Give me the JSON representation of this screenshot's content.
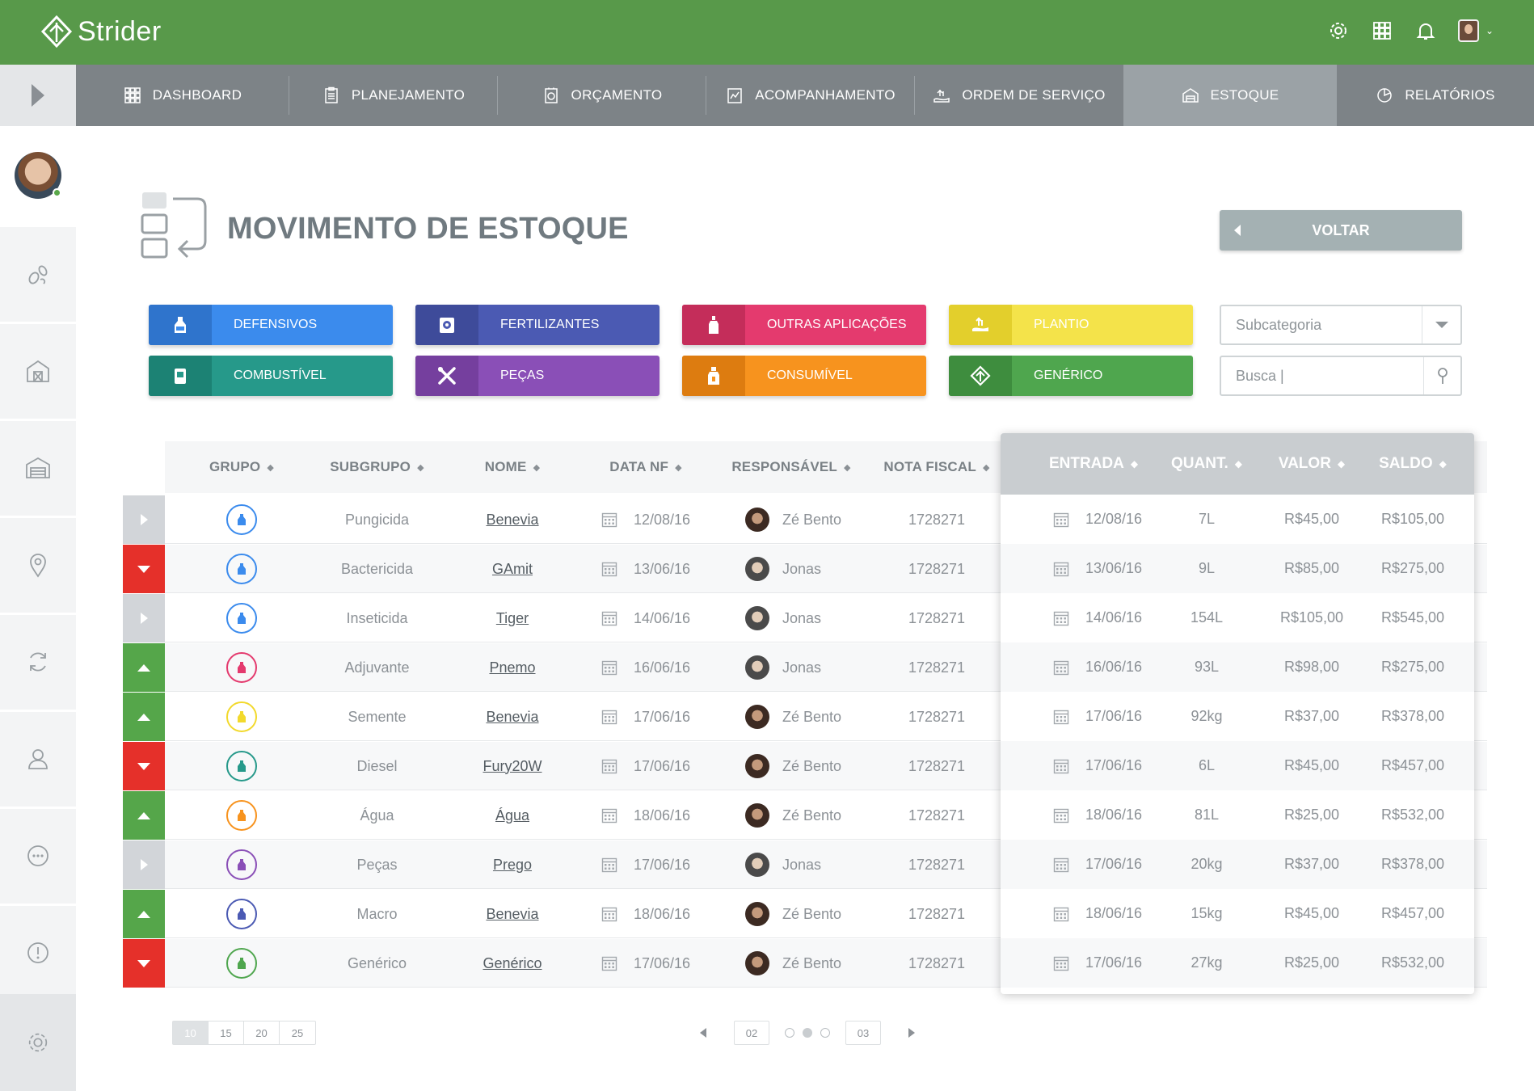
{
  "app": {
    "name": "Strider"
  },
  "nav": {
    "tabs": [
      {
        "label": "DASHBOARD",
        "icon": "grid-icon"
      },
      {
        "label": "PLANEJAMENTO",
        "icon": "clipboard-icon"
      },
      {
        "label": "ORÇAMENTO",
        "icon": "budget-icon"
      },
      {
        "label": "ACOMPANHAMENTO",
        "icon": "chart-icon"
      },
      {
        "label": "ORDEM DE SERVIÇO",
        "icon": "service-order-icon"
      },
      {
        "label": "ESTOQUE",
        "icon": "warehouse-icon",
        "active": true
      },
      {
        "label": "RELATÓRIOS",
        "icon": "pie-icon"
      }
    ]
  },
  "page": {
    "title": "MOVIMENTO DE ESTOQUE",
    "back_label": "VOLTAR"
  },
  "categories": [
    {
      "label": "DEFENSIVOS",
      "color": "#3b8bed",
      "dark": "#2f74cc",
      "icon": "bottle-icon"
    },
    {
      "label": "FERTILIZANTES",
      "color": "#4b5ab3",
      "dark": "#3e4b9a",
      "icon": "fertilizer-icon"
    },
    {
      "label": "OUTRAS APLICAÇÕES",
      "color": "#e43a6e",
      "dark": "#c42d5a",
      "icon": "spray-bottle-icon"
    },
    {
      "label": "PLANTIO",
      "color": "#f4e34a",
      "dark": "#e3cf2c",
      "icon": "planting-icon"
    },
    {
      "label": "COMBUSTÍVEL",
      "color": "#26998a",
      "dark": "#1c8274",
      "icon": "fuel-icon"
    },
    {
      "label": "PEÇAS",
      "color": "#8a4fb7",
      "dark": "#753f9e",
      "icon": "tools-icon"
    },
    {
      "label": "CONSUMÍVEL",
      "color": "#f7931e",
      "dark": "#dd7c10",
      "icon": "consumable-icon"
    },
    {
      "label": "GENÉRICO",
      "color": "#4fa64e",
      "dark": "#3e8d3e",
      "icon": "diamond-icon"
    }
  ],
  "filters": {
    "subcategory_placeholder": "Subcategoria",
    "search_value": "Busca |"
  },
  "table": {
    "columns": [
      "GRUPO",
      "SUBGRUPO",
      "NOME",
      "DATA NF",
      "RESPONSÁVEL",
      "NOTA FISCAL"
    ],
    "panel_columns": [
      "ENTRADA",
      "QUANT.",
      "VALOR",
      "SALDO"
    ],
    "rows": [
      {
        "status": "neutral",
        "group_color": "#3b8bed",
        "subgroup": "Pungicida",
        "name": "Benevia",
        "date_nf": "12/08/16",
        "responsible": "Zé Bento",
        "nota_fiscal": "1728271",
        "entry": "12/08/16",
        "qty": "7L",
        "value": "R$45,00",
        "balance": "R$105,00"
      },
      {
        "status": "down",
        "group_color": "#3b8bed",
        "subgroup": "Bactericida",
        "name": "GAmit",
        "date_nf": "13/06/16",
        "responsible": "Jonas",
        "nota_fiscal": "1728271",
        "entry": "13/06/16",
        "qty": "9L",
        "value": "R$85,00",
        "balance": "R$275,00"
      },
      {
        "status": "neutral",
        "group_color": "#3b8bed",
        "subgroup": "Inseticida",
        "name": "Tiger",
        "date_nf": "14/06/16",
        "responsible": "Jonas",
        "nota_fiscal": "1728271",
        "entry": "14/06/16",
        "qty": "154L",
        "value": "R$105,00",
        "balance": "R$545,00"
      },
      {
        "status": "up",
        "group_color": "#e43a6e",
        "subgroup": "Adjuvante",
        "name": "Pnemo",
        "date_nf": "16/06/16",
        "responsible": "Jonas",
        "nota_fiscal": "1728271",
        "entry": "16/06/16",
        "qty": "93L",
        "value": "R$98,00",
        "balance": "R$275,00"
      },
      {
        "status": "up",
        "group_color": "#f2d92c",
        "subgroup": "Semente",
        "name": "Benevia",
        "date_nf": "17/06/16",
        "responsible": "Zé Bento",
        "nota_fiscal": "1728271",
        "entry": "17/06/16",
        "qty": "92kg",
        "value": "R$37,00",
        "balance": "R$378,00"
      },
      {
        "status": "down",
        "group_color": "#26998a",
        "subgroup": "Diesel",
        "name": "Fury20W",
        "date_nf": "17/06/16",
        "responsible": "Zé Bento",
        "nota_fiscal": "1728271",
        "entry": "17/06/16",
        "qty": "6L",
        "value": "R$45,00",
        "balance": "R$457,00"
      },
      {
        "status": "up",
        "group_color": "#f7931e",
        "subgroup": "Água",
        "name": "Água",
        "date_nf": "18/06/16",
        "responsible": "Zé Bento",
        "nota_fiscal": "1728271",
        "entry": "18/06/16",
        "qty": "81L",
        "value": "R$25,00",
        "balance": "R$532,00"
      },
      {
        "status": "neutral",
        "group_color": "#8a4fb7",
        "subgroup": "Peças",
        "name": "Prego",
        "date_nf": "17/06/16",
        "responsible": "Jonas",
        "nota_fiscal": "1728271",
        "entry": "17/06/16",
        "qty": "20kg",
        "value": "R$37,00",
        "balance": "R$378,00"
      },
      {
        "status": "up",
        "group_color": "#4b5ab3",
        "subgroup": "Macro",
        "name": "Benevia",
        "date_nf": "18/06/16",
        "responsible": "Zé Bento",
        "nota_fiscal": "1728271",
        "entry": "18/06/16",
        "qty": "15kg",
        "value": "R$45,00",
        "balance": "R$457,00"
      },
      {
        "status": "down",
        "group_color": "#4fa64e",
        "subgroup": "Genérico",
        "name": "Genérico",
        "date_nf": "17/06/16",
        "responsible": "Zé Bento",
        "nota_fiscal": "1728271",
        "entry": "17/06/16",
        "qty": "27kg",
        "value": "R$25,00",
        "balance": "R$532,00"
      }
    ]
  },
  "pagination": {
    "page_sizes": [
      "10",
      "15",
      "20",
      "25"
    ],
    "selected_size": "10",
    "prev_page": "02",
    "next_page": "03",
    "current_dot": 2
  }
}
